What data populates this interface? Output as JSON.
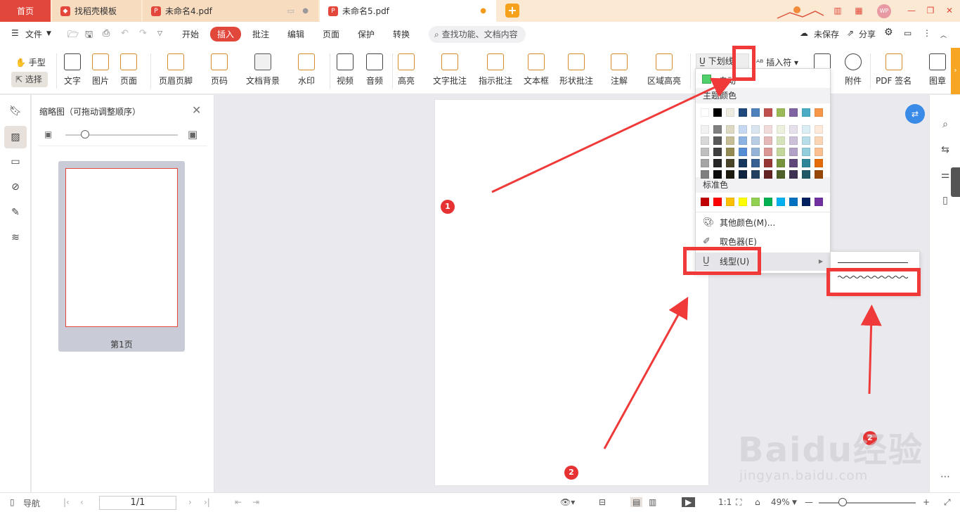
{
  "tabs": [
    {
      "label": "首页"
    },
    {
      "label": "找稻壳模板"
    },
    {
      "label": "未命名4.pdf"
    },
    {
      "label": "未命名5.pdf"
    }
  ],
  "menu": {
    "file": "文件",
    "items": [
      "开始",
      "插入",
      "批注",
      "编辑",
      "页面",
      "保护",
      "转换"
    ],
    "search_placeholder": "查找功能、文档内容",
    "unsaved": "未保存",
    "share": "分享"
  },
  "ribbon": {
    "hand": "手型",
    "select": "选择",
    "buttons": [
      "文字",
      "图片",
      "页面",
      "页眉页脚",
      "页码",
      "文档背景",
      "水印",
      "视频",
      "音频",
      "高亮",
      "文字批注",
      "指示批注",
      "文本框",
      "形状批注",
      "注解",
      "区域高亮"
    ],
    "underline": "下划线",
    "insert_symbol": "插入符",
    "attach": "附件",
    "pdf_sign": "PDF 签名",
    "stamp": "图章"
  },
  "thumbnail_panel": {
    "title": "缩略图（可拖动调整顺序）",
    "page_label": "第1页"
  },
  "color_menu": {
    "auto": "自动",
    "theme_colors_label": "主题颜色",
    "standard_colors_label": "标准色",
    "more_colors": "其他颜色(M)...",
    "eyedropper": "取色器(E)",
    "line_type": "线型(U)",
    "theme_top": [
      "#ffffff",
      "#000000",
      "#eeece1",
      "#1f497d",
      "#4f81bd",
      "#c0504d",
      "#9bbb59",
      "#8064a2",
      "#4bacc6",
      "#f79646"
    ],
    "theme_shades": [
      [
        "#f2f2f2",
        "#7f7f7f",
        "#ddd9c3",
        "#c6d9f0",
        "#dbe5f1",
        "#f2dcdb",
        "#ebf1dd",
        "#e5e0ec",
        "#dbeef3",
        "#fdeada"
      ],
      [
        "#d8d8d8",
        "#595959",
        "#c4bd97",
        "#8db3e2",
        "#b8cce4",
        "#e5b9b7",
        "#d7e3bc",
        "#ccc1d9",
        "#b7dde8",
        "#fbd5b5"
      ],
      [
        "#bfbfbf",
        "#3f3f3f",
        "#938953",
        "#548dd4",
        "#95b3d7",
        "#d99694",
        "#c3d69b",
        "#b2a2c7",
        "#92cddc",
        "#fac08f"
      ],
      [
        "#a5a5a5",
        "#262626",
        "#494429",
        "#17365d",
        "#366092",
        "#953734",
        "#76923c",
        "#5f497a",
        "#31859b",
        "#e36c09"
      ],
      [
        "#7f7f7f",
        "#0c0c0c",
        "#1d1b10",
        "#0f243e",
        "#244061",
        "#632423",
        "#4f6128",
        "#3f3151",
        "#205867",
        "#974806"
      ]
    ],
    "standard": [
      "#c00000",
      "#ff0000",
      "#ffc000",
      "#ffff00",
      "#92d050",
      "#00b050",
      "#00b0f0",
      "#0070c0",
      "#002060",
      "#7030a0"
    ]
  },
  "annotations": {
    "badge1": "1",
    "badge2": "2",
    "badge3": "2"
  },
  "watermark": {
    "main": "Baidu经验",
    "sub": "jingyan.baidu.com"
  },
  "statusbar": {
    "nav": "导航",
    "page_value": "1/1",
    "zoom": "49%"
  }
}
